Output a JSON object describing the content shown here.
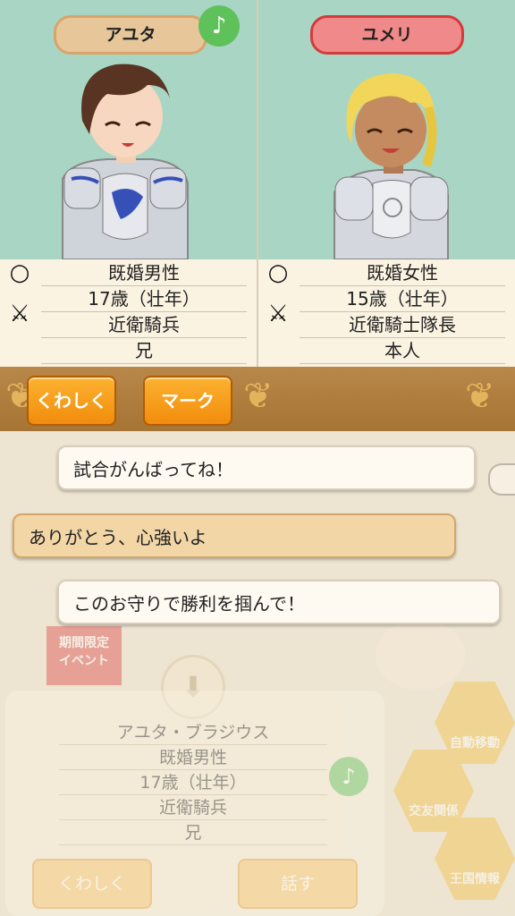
{
  "left_character": {
    "name": "アユタ",
    "rows": [
      "既婚男性",
      "17歳（壮年）",
      "近衛騎兵",
      "兄"
    ]
  },
  "right_character": {
    "name": "ユメリ",
    "rows": [
      "既婚女性",
      "15歳（壮年）",
      "近衛騎士隊長",
      "本人"
    ]
  },
  "music_badge": "♪",
  "action_buttons": {
    "details": "くわしく",
    "mark": "マーク"
  },
  "dialogue": [
    {
      "speaker": "right",
      "text": "試合がんばってね！"
    },
    {
      "speaker": "left",
      "text": "ありがとう、心強いよ"
    },
    {
      "speaker": "right",
      "text": "このお守りで勝利を掴んで！"
    }
  ],
  "background_ui": {
    "event_badge": "期間限定\nイベント",
    "menu": [
      "自動移動",
      "交友関係",
      "王国情報"
    ],
    "card": {
      "name": "アユタ・ブラジウス",
      "rows": [
        "既婚男性",
        "17歳（壮年）",
        "近衛騎兵",
        "兄"
      ],
      "details_button": "くわしく",
      "talk_button": "話す"
    }
  },
  "colors": {
    "panel_bg": "#a9d5c4",
    "accent_orange": "#f28c0c",
    "name_left": "#e7c79a",
    "name_right": "#f08a8a"
  }
}
